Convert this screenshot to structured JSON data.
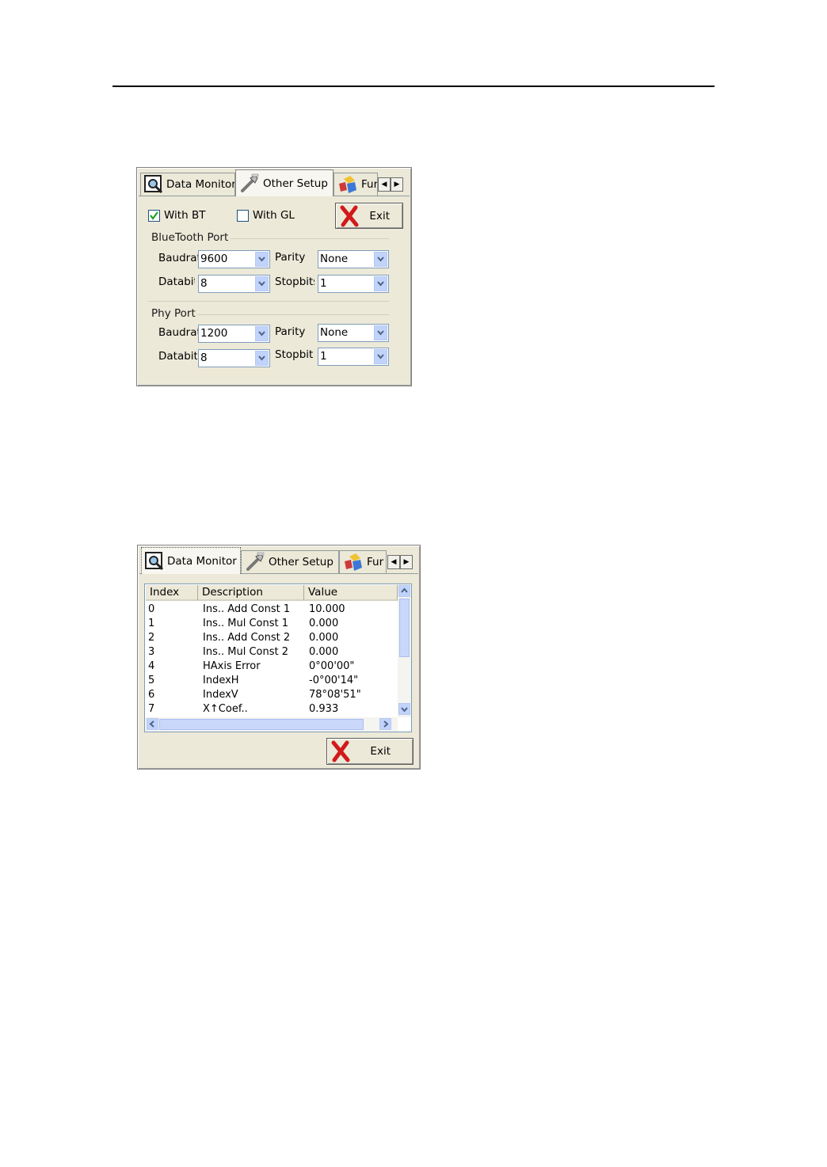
{
  "window1": {
    "tabs": [
      {
        "label": "Data Monitor",
        "icon": "monitor-icon"
      },
      {
        "label": "Other Setup",
        "icon": "setup-icon"
      },
      {
        "label": "Fur",
        "icon": "function-icon"
      }
    ],
    "active_tab": 1,
    "with_bt": {
      "label": "With BT",
      "checked": true
    },
    "with_gl": {
      "label": "With GL",
      "checked": false
    },
    "exit_label": "Exit",
    "bluetooth": {
      "title": "BlueTooth Port",
      "baudrate_label": "Baudrate",
      "baudrate_value": "9600",
      "parity_label": "Parity",
      "parity_value": "None",
      "databits_label": "Databits",
      "databits_value": "8",
      "stopbits_label": "Stopbits",
      "stopbits_value": "1"
    },
    "phy": {
      "title": "Phy Port",
      "baudrate_label": "Baudrate",
      "baudrate_value": "1200",
      "parity_label": "Parity",
      "parity_value": "None",
      "databits_label": "Databits",
      "databits_value": "8",
      "stopbits_label": "Stopbits",
      "stopbits_value": "1"
    }
  },
  "window2": {
    "tabs": [
      {
        "label": "Data Monitor",
        "icon": "monitor-icon"
      },
      {
        "label": "Other Setup",
        "icon": "setup-icon"
      },
      {
        "label": "Fur",
        "icon": "function-icon"
      }
    ],
    "active_tab": 0,
    "columns": [
      "Index",
      "Description",
      "Value"
    ],
    "rows": [
      [
        "0",
        "Ins.. Add Const 1",
        "10.000"
      ],
      [
        "1",
        "Ins.. Mul Const 1",
        "0.000"
      ],
      [
        "2",
        "Ins.. Add Const 2",
        "0.000"
      ],
      [
        "3",
        "Ins.. Mul Const 2",
        "0.000"
      ],
      [
        "4",
        "HAxis Error",
        "0°00'00\""
      ],
      [
        "5",
        "IndexH",
        "-0°00'14\""
      ],
      [
        "6",
        "IndexV",
        "78°08'51\""
      ],
      [
        "7",
        "X↑Coef..",
        "0.933"
      ]
    ],
    "exit_label": "Exit"
  }
}
